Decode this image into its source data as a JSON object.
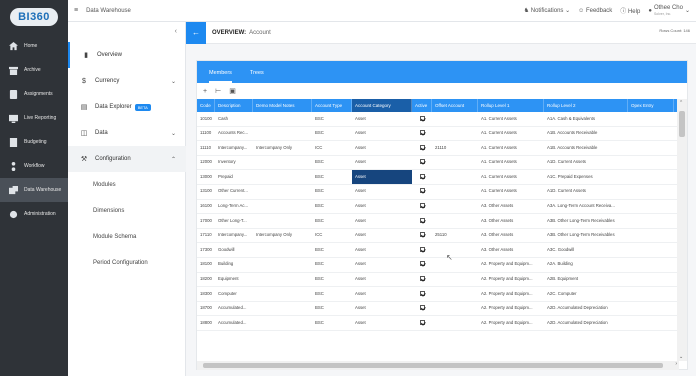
{
  "app": {
    "logo": "BI360"
  },
  "rail": [
    {
      "label": "Home",
      "icon": "home-icon"
    },
    {
      "label": "Archive",
      "icon": "archive-icon"
    },
    {
      "label": "Assignments",
      "icon": "assignments-icon"
    },
    {
      "label": "Live Reporting",
      "icon": "live-reporting-icon"
    },
    {
      "label": "Budgeting",
      "icon": "budgeting-icon"
    },
    {
      "label": "Workflow",
      "icon": "workflow-icon"
    },
    {
      "label": "Data Warehouse",
      "icon": "data-warehouse-icon",
      "active": true
    },
    {
      "label": "Administration",
      "icon": "administration-icon"
    }
  ],
  "topbar": {
    "title": "Data Warehouse",
    "notifications": "Notifications",
    "feedback": "Feedback",
    "help": "Help",
    "user_name": "Othee Cho",
    "user_sub": "Solver, Inc."
  },
  "module_sidebar": {
    "items": [
      {
        "label": "Overview",
        "icon": "overview-icon"
      },
      {
        "label": "Currency",
        "icon": "currency-icon"
      },
      {
        "label": "Data Explorer",
        "icon": "data-explorer-icon",
        "badge": "BETA"
      },
      {
        "label": "Data",
        "icon": "data-icon"
      },
      {
        "label": "Configuration",
        "icon": "configuration-icon"
      }
    ],
    "sub_items": [
      "Modules",
      "Dimensions",
      "Module Schema",
      "Period Configuration"
    ]
  },
  "overview": {
    "title": "OVERVIEW:",
    "subtitle": "Account",
    "rows_count": "Rows Count: 146"
  },
  "tabs": [
    "Members",
    "Trees"
  ],
  "grid": {
    "columns": [
      "Code",
      "Description",
      "Demo Model Notes",
      "Account Type",
      "Account Category",
      "Active",
      "Offset Account",
      "Rollup Level 1",
      "Rollup Level 2",
      "Opex Entry"
    ],
    "rows": [
      [
        "10100",
        "Cash",
        "",
        "BSC",
        "Asset",
        true,
        "",
        "A1. Current Assets",
        "A1A. Cash & Equivalents"
      ],
      [
        "11100",
        "Accounts Rec...",
        "",
        "BSC",
        "Asset",
        true,
        "",
        "A1. Current Assets",
        "A1B. Accounts Receivable"
      ],
      [
        "11110",
        "Intercompany...",
        "Intercompany Only",
        "ICC",
        "Asset",
        true,
        "21110",
        "A1. Current Assets",
        "A1B. Accounts Receivable"
      ],
      [
        "12000",
        "Inventory",
        "",
        "BSC",
        "Asset",
        true,
        "",
        "A1. Current Assets",
        "A1D. Current Assets"
      ],
      [
        "13000",
        "Prepaid",
        "",
        "BSC",
        "Asset",
        true,
        "",
        "A1. Current Assets",
        "A1C. Prepaid Expenses"
      ],
      [
        "13100",
        "Other Current...",
        "",
        "BSC",
        "Asset",
        true,
        "",
        "A1. Current Assets",
        "A1D. Current Assets"
      ],
      [
        "16100",
        "Long-Term Ac...",
        "",
        "BSC",
        "Asset",
        true,
        "",
        "A3. Other Assets",
        "A3A. Long-Term Account Receiva..."
      ],
      [
        "17000",
        "Other Long-T...",
        "",
        "BSC",
        "Asset",
        true,
        "",
        "A3. Other Assets",
        "A3B. Other Long-Term Receivables"
      ],
      [
        "17110",
        "Intercompany...",
        "Intercompany Only",
        "ICC",
        "Asset",
        true,
        "25110",
        "A3. Other Assets",
        "A3B. Other Long-Term Receivables"
      ],
      [
        "17300",
        "Goodwill",
        "",
        "BSC",
        "Asset",
        true,
        "",
        "A3. Other Assets",
        "A3C. Goodwill"
      ],
      [
        "18100",
        "Building",
        "",
        "BSC",
        "Asset",
        true,
        "",
        "A2. Property and Equipm...",
        "A2A. Building"
      ],
      [
        "18200",
        "Equipment",
        "",
        "BSC",
        "Asset",
        true,
        "",
        "A2. Property and Equipm...",
        "A2B. Equipment"
      ],
      [
        "18300",
        "Computer",
        "",
        "BSC",
        "Asset",
        true,
        "",
        "A2. Property and Equipm...",
        "A2C. Computer"
      ],
      [
        "18700",
        "Accumulated...",
        "",
        "BSC",
        "Asset",
        true,
        "",
        "A2. Property and Equipm...",
        "A2D. Accumulated Depreciation"
      ],
      [
        "18800",
        "Accumulated...",
        "",
        "BSC",
        "Asset",
        true,
        "",
        "A2. Property and Equipm...",
        "A2D. Accumulated Depreciation"
      ]
    ]
  }
}
